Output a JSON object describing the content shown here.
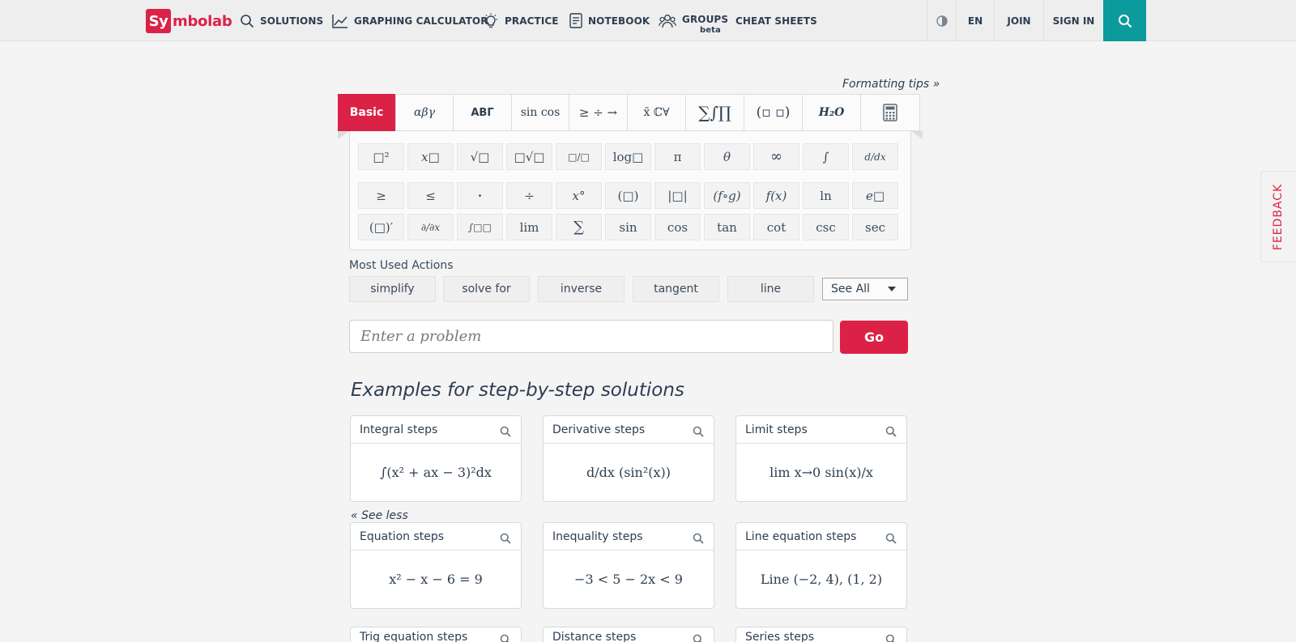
{
  "header": {
    "logo_badge": "Sy",
    "logo_rest": "mbolab",
    "nav": {
      "solutions": "SOLUTIONS",
      "graphing": "GRAPHING CALCULATOR",
      "practice": "PRACTICE",
      "notebook": "NOTEBOOK",
      "groups": "GROUPS",
      "groups_badge": "beta",
      "cheat_sheets": "CHEAT SHEETS"
    },
    "language": "EN",
    "join": "JOIN",
    "sign_in": "SIGN IN"
  },
  "keypad": {
    "formatting_tips": "Formatting tips »",
    "tabs": [
      "Basic",
      "αβγ",
      "ΑΒΓ",
      "sin cos",
      "≥ ÷ →",
      "x̄ ℂ∀",
      "∑∫∏",
      "(▫ ▫)",
      "H₂O",
      "calculator"
    ],
    "rows": [
      [
        "□²",
        "x□",
        "√□",
        "□√□",
        "□/□",
        "log□",
        "π",
        "θ",
        "∞",
        "∫",
        "d/dx"
      ],
      [
        "≥",
        "≤",
        "·",
        "÷",
        "x°",
        "(□)",
        "|□|",
        "(f∘g)",
        "f(x)",
        "ln",
        "e□"
      ],
      [
        "(□)′",
        "∂/∂x",
        "∫□□",
        "lim",
        "∑",
        "sin",
        "cos",
        "tan",
        "cot",
        "csc",
        "sec"
      ]
    ]
  },
  "most_used": {
    "label": "Most Used Actions",
    "actions": [
      "simplify",
      "solve for",
      "inverse",
      "tangent",
      "line"
    ],
    "see_all": "See All"
  },
  "input": {
    "placeholder": "Enter a problem",
    "go": "Go"
  },
  "examples": {
    "title": "Examples for step-by-step solutions",
    "see_less": "« See less",
    "cards": [
      {
        "title": "Integral steps",
        "expr": "∫(x² + ax − 3)²dx"
      },
      {
        "title": "Derivative steps",
        "expr": "d/dx (sin²(x))"
      },
      {
        "title": "Limit steps",
        "expr": "lim x→0 sin(x)/x"
      },
      {
        "title": "Equation steps",
        "expr": "x² − x − 6 = 9"
      },
      {
        "title": "Inequality steps",
        "expr": "−3 < 5 − 2x < 9"
      },
      {
        "title": "Line equation steps",
        "expr": "Line (−2, 4), (1, 2)"
      },
      {
        "title": "Trig equation steps",
        "expr": ""
      },
      {
        "title": "Distance steps",
        "expr": ""
      },
      {
        "title": "Series steps",
        "expr": ""
      }
    ]
  },
  "feedback": "FEEDBACK",
  "colors": {
    "brand": "#dc2146",
    "search_accent": "#0d9a9c",
    "text": "#2d3e50"
  }
}
